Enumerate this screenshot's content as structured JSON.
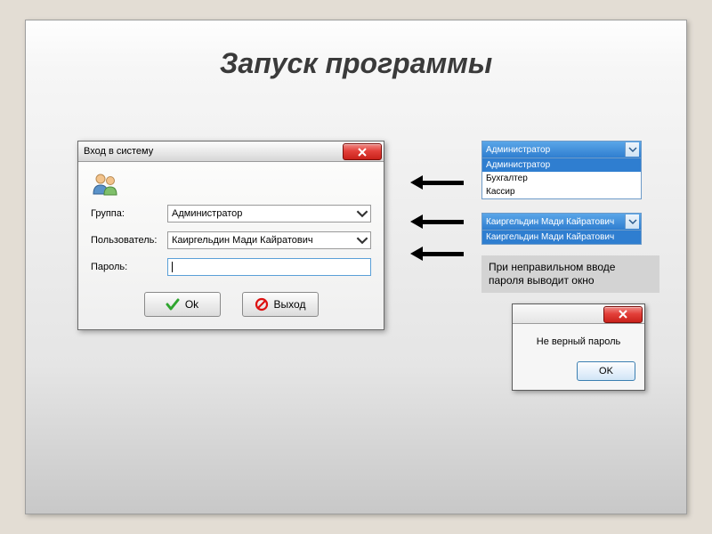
{
  "slide": {
    "title": "Запуск программы"
  },
  "login": {
    "window_title": "Вход в систему",
    "group_label": "Группа:",
    "group_value": "Администратор",
    "user_label": "Пользователь:",
    "user_value": "Каиргельдин Мади Кайратович",
    "password_label": "Пароль:",
    "password_value": "",
    "ok_label": "Ok",
    "exit_label": "Выход"
  },
  "group_dropdown": {
    "selected": "Администратор",
    "options": [
      "Администратор",
      "Бухгалтер",
      "Кассир"
    ],
    "highlighted_index": 0
  },
  "user_dropdown": {
    "selected": "Каиргельдин Мади Кайратович",
    "options": [
      "Каиргельдин Мади Кайратович"
    ],
    "highlighted_index": 0
  },
  "note": {
    "text": "При неправильном вводе пароля выводит окно"
  },
  "error": {
    "message": "Не верный пароль",
    "ok_label": "OK"
  },
  "icons": {
    "close": "close-icon",
    "users": "users-icon",
    "check": "check-icon",
    "forbid": "forbid-icon",
    "chevron_down": "chevron-down-icon"
  }
}
